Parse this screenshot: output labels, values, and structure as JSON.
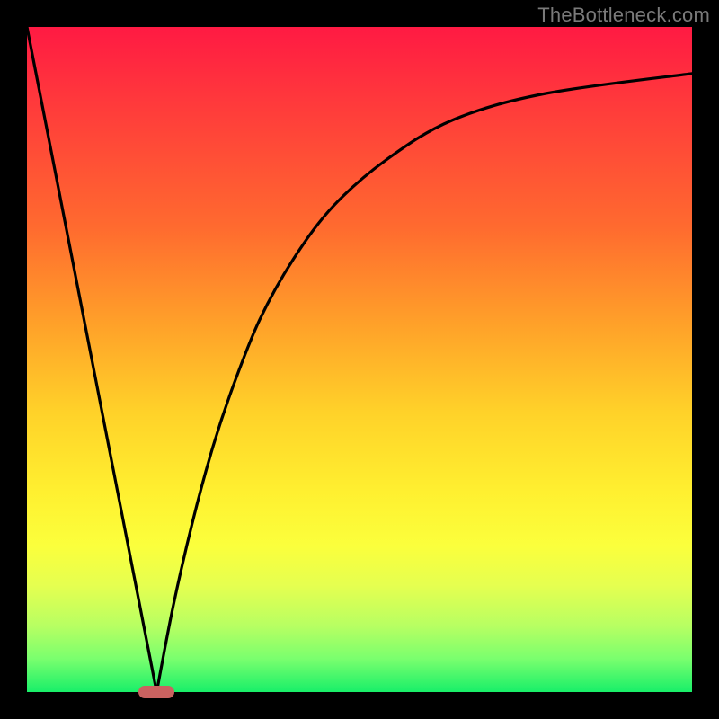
{
  "watermark": "TheBottleneck.com",
  "chart_data": {
    "type": "line",
    "title": "",
    "xlabel": "",
    "ylabel": "",
    "xlim": [
      0,
      100
    ],
    "ylim": [
      0,
      100
    ],
    "grid": false,
    "legend": false,
    "series": [
      {
        "name": "left-line",
        "x": [
          0,
          19.5
        ],
        "y": [
          100,
          0
        ]
      },
      {
        "name": "right-curve",
        "x": [
          19.5,
          22,
          25,
          28,
          31,
          35,
          40,
          46,
          54,
          64,
          78,
          100
        ],
        "y": [
          0,
          13,
          26,
          37,
          46,
          56,
          65,
          73,
          80,
          86,
          90,
          93
        ]
      }
    ],
    "marker": {
      "x": 19.5,
      "y": 0,
      "shape": "pill",
      "color": "#ca6260"
    },
    "background_gradient": {
      "orientation": "vertical",
      "stops": [
        {
          "pos": 0,
          "color": "#ff1a43"
        },
        {
          "pos": 30,
          "color": "#ff6a2f"
        },
        {
          "pos": 58,
          "color": "#ffd229"
        },
        {
          "pos": 78,
          "color": "#fbff3c"
        },
        {
          "pos": 100,
          "color": "#18ef69"
        }
      ]
    }
  }
}
